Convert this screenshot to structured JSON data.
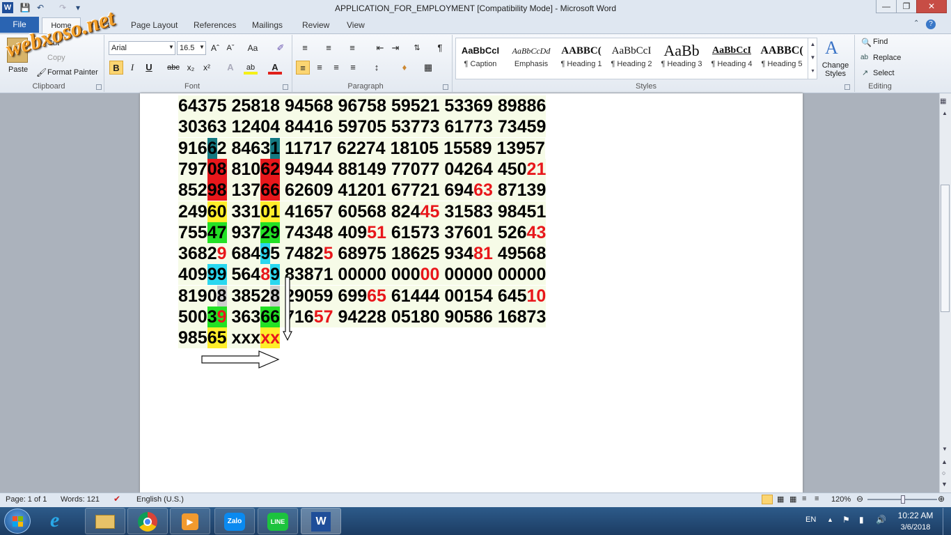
{
  "window": {
    "title": "APPLICATION_FOR_EMPLOYMENT [Compatibility Mode] - Microsoft Word",
    "word_icon": "W",
    "minimize": "—",
    "restore": "❐",
    "close": "✕"
  },
  "watermark": "webxoso.net",
  "tabs": {
    "file": "File",
    "home": "Home",
    "insert": "Insert",
    "page_layout": "Page Layout",
    "references": "References",
    "mailings": "Mailings",
    "review": "Review",
    "view": "View"
  },
  "clipboard": {
    "paste": "Paste",
    "cut": "Cut",
    "copy": "Copy",
    "format_painter": "Format Painter",
    "label": "Clipboard"
  },
  "font": {
    "name": "Arial",
    "size": "16.5",
    "label": "Font"
  },
  "paragraph": {
    "label": "Paragraph"
  },
  "styles": {
    "label": "Styles",
    "items": [
      {
        "sample": "AaBbCcI",
        "name": "¶ Caption"
      },
      {
        "sample": "AaBbCcDd",
        "name": "Emphasis"
      },
      {
        "sample": "AABBC(",
        "name": "¶ Heading 1"
      },
      {
        "sample": "AaBbCcI",
        "name": "¶ Heading 2"
      },
      {
        "sample": "AaBb",
        "name": "¶ Heading 3"
      },
      {
        "sample": "AaBbCcI",
        "name": "¶ Heading 4"
      },
      {
        "sample": "AABBC(",
        "name": "¶ Heading 5"
      }
    ],
    "change_styles": "Change Styles"
  },
  "editing": {
    "label": "Editing",
    "find": "Find",
    "replace": "Replace",
    "select": "Select"
  },
  "table_rows": [
    [
      {
        "t": "64375"
      },
      {
        "t": " "
      },
      {
        "t": "25818"
      },
      {
        "t": " "
      },
      {
        "t": "94568"
      },
      {
        "t": " "
      },
      {
        "t": "96758"
      },
      {
        "t": " "
      },
      {
        "t": "59521"
      },
      {
        "t": " "
      },
      {
        "t": "53369"
      },
      {
        "t": " "
      },
      {
        "t": "89886"
      }
    ],
    [
      {
        "t": "30363"
      },
      {
        "t": " "
      },
      {
        "t": "12404"
      },
      {
        "t": " "
      },
      {
        "t": "84416"
      },
      {
        "t": " "
      },
      {
        "t": "59705"
      },
      {
        "t": " "
      },
      {
        "t": "53773"
      },
      {
        "t": " "
      },
      {
        "t": "61773"
      },
      {
        "t": " "
      },
      {
        "t": "73459"
      }
    ],
    [
      {
        "t": "916"
      },
      {
        "t": "6",
        "bg": "teal"
      },
      {
        "t": "2 "
      },
      {
        "t": "8463"
      },
      {
        "t": "1",
        "bg": "teal"
      },
      {
        "t": " 11717 62274 18105 15589 13957"
      }
    ],
    [
      {
        "t": "797"
      },
      {
        "t": "08",
        "bg": "red"
      },
      {
        "t": " 810"
      },
      {
        "t": "62",
        "bg": "red"
      },
      {
        "t": " 94944 88149 77077 04264 450"
      },
      {
        "t": "21",
        "fg": "red"
      }
    ],
    [
      {
        "t": "852"
      },
      {
        "t": "98",
        "bg": "red"
      },
      {
        "t": " 137"
      },
      {
        "t": "66",
        "bg": "red"
      },
      {
        "t": " 62609 41201 67721 694"
      },
      {
        "t": "63",
        "fg": "red"
      },
      {
        "t": " 87139"
      }
    ],
    [
      {
        "t": "249"
      },
      {
        "t": "60",
        "bg": "yellow"
      },
      {
        "t": " 331"
      },
      {
        "t": "01",
        "bg": "yellow"
      },
      {
        "t": " 41657 60568 824"
      },
      {
        "t": "45",
        "fg": "red"
      },
      {
        "t": " 31583 98451"
      }
    ],
    [
      {
        "t": "755"
      },
      {
        "t": "47",
        "bg": "green"
      },
      {
        "t": " 937"
      },
      {
        "t": "29",
        "bg": "green"
      },
      {
        "t": " 74348 409"
      },
      {
        "t": "51",
        "fg": "red"
      },
      {
        "t": " 61573 37601 526"
      },
      {
        "t": "43",
        "fg": "red"
      }
    ],
    [
      {
        "t": "3682"
      },
      {
        "t": "9",
        "fg": "red"
      },
      {
        "t": " 684"
      },
      {
        "t": "9",
        "bg": "cyan"
      },
      {
        "t": "5 7482"
      },
      {
        "t": "5",
        "fg": "red"
      },
      {
        "t": " 68975 18625 934"
      },
      {
        "t": "81",
        "fg": "red"
      },
      {
        "t": " 49568"
      }
    ],
    [
      {
        "t": "409"
      },
      {
        "t": "99",
        "bg": "cyan"
      },
      {
        "t": " 564"
      },
      {
        "t": "8",
        "fg": "red"
      },
      {
        "t": "9",
        "bg": "cyan"
      },
      {
        "t": " 83871 00000 000"
      },
      {
        "t": "00",
        "fg": "red"
      },
      {
        "t": " 00000 00000"
      }
    ],
    [
      {
        "t": "8190"
      },
      {
        "t": "8",
        "bg": "gray"
      },
      {
        "t": " 3852"
      },
      {
        "t": "8",
        "bg": "gray"
      },
      {
        "t": " 29059 699"
      },
      {
        "t": "65",
        "fg": "red"
      },
      {
        "t": " 61444 00154 645"
      },
      {
        "t": "10",
        "fg": "red"
      }
    ],
    [
      {
        "t": "500"
      },
      {
        "t": "3",
        "bg": "green"
      },
      {
        "t": "9",
        "bg": "green",
        "fg": "red"
      },
      {
        "t": " 363"
      },
      {
        "t": "66",
        "bg": "green"
      },
      {
        "t": " 716"
      },
      {
        "t": "57",
        "fg": "red"
      },
      {
        "t": " 94228 05180 90586 16873"
      }
    ],
    [
      {
        "t": "985"
      },
      {
        "t": "65",
        "bg": "yellow"
      },
      {
        "t": " xxx"
      },
      {
        "t": "xx",
        "bg": "yellow",
        "fg": "red"
      }
    ]
  ],
  "status": {
    "page": "Page: 1 of 1",
    "words": "Words: 121",
    "language": "English (U.S.)",
    "zoom": "120%"
  },
  "tray": {
    "lang": "EN",
    "time": "10:22 AM",
    "date": "3/6/2018"
  },
  "taskbar_apps": [
    "start-button",
    "ie-icon",
    "explorer-icon",
    "chrome-icon",
    "media-icon",
    "zalo-icon",
    "line-icon",
    "word-icon"
  ],
  "taskbar_labels": {
    "zalo": "Zalo",
    "line": "LINE"
  }
}
